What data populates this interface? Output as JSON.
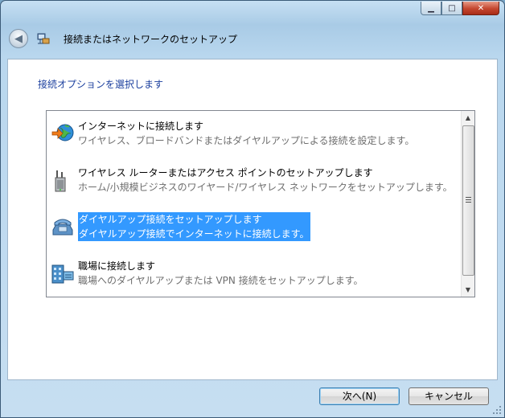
{
  "window": {
    "title": "接続またはネットワークのセットアップ",
    "minimize_glyph": "▁",
    "maximize_glyph": "□",
    "close_glyph": "✕"
  },
  "header": {
    "back_glyph": "◀",
    "title": "接続またはネットワークのセットアップ"
  },
  "content": {
    "heading": "接続オプションを選択します"
  },
  "options": [
    {
      "title": "インターネットに接続します",
      "desc": "ワイヤレス、ブロードバンドまたはダイヤルアップによる接続を設定します。",
      "icon": "globe-internet-icon"
    },
    {
      "title": "ワイヤレス ルーターまたはアクセス ポイントのセットアップします",
      "desc": "ホーム/小規模ビジネスのワイヤード/ワイヤレス ネットワークをセットアップします。",
      "icon": "wireless-router-icon"
    },
    {
      "title": "ダイヤルアップ接続をセットアップします",
      "desc": "ダイヤルアップ接続でインターネットに接続します。",
      "icon": "telephone-icon"
    },
    {
      "title": "職場に接続します",
      "desc": "職場へのダイヤルアップまたは VPN 接続をセットアップします。",
      "icon": "workplace-network-icon"
    }
  ],
  "selected_index": 2,
  "scrollbar": {
    "up_glyph": "▲",
    "down_glyph": "▼"
  },
  "footer": {
    "next_label": "次へ(N)",
    "cancel_label": "キャンセル"
  },
  "colors": {
    "selection": "#3399ff",
    "heading": "#1b3f9e",
    "close_button": "#c4462f"
  }
}
